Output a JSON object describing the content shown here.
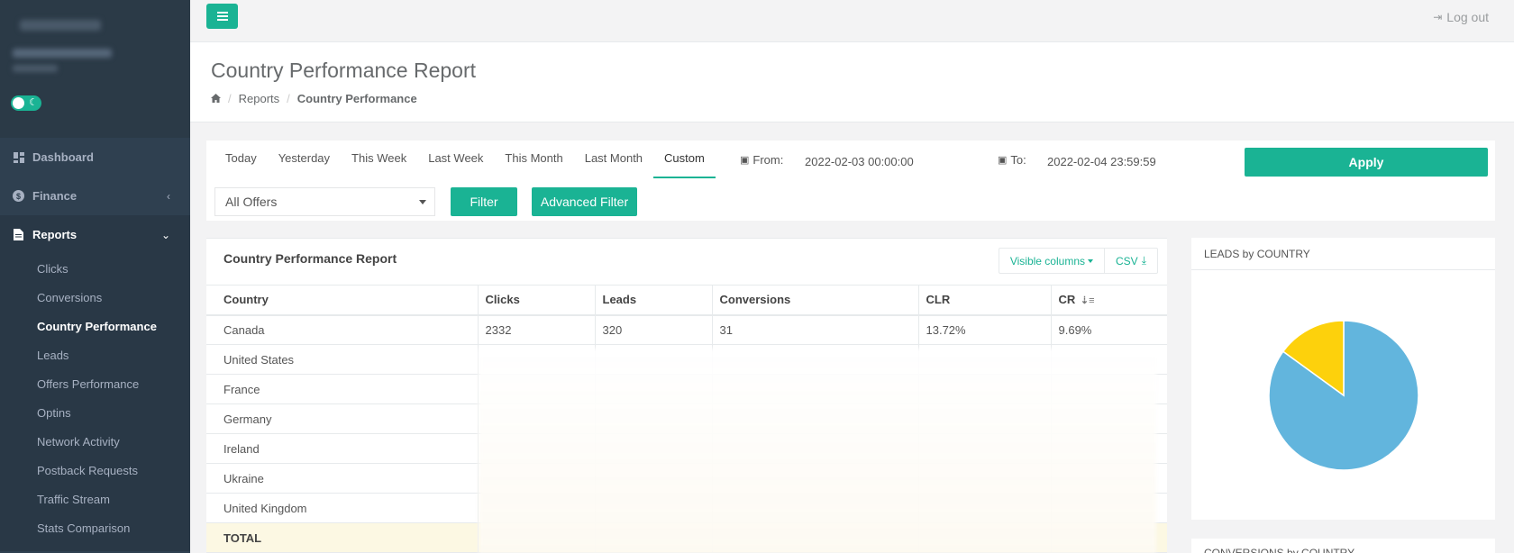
{
  "sidebar": {
    "items": [
      {
        "label": "Dashboard",
        "icon": "dashboard-icon"
      },
      {
        "label": "Finance",
        "icon": "dollar-icon"
      },
      {
        "label": "Reports",
        "icon": "file-icon"
      }
    ],
    "reports_sub": [
      "Clicks",
      "Conversions",
      "Country Performance",
      "Leads",
      "Offers Performance",
      "Optins",
      "Network Activity",
      "Postback Requests",
      "Traffic Stream",
      "Stats Comparison"
    ],
    "current": "Country Performance"
  },
  "topbar": {
    "logout_label": "Log out"
  },
  "heading": {
    "title": "Country Performance Report",
    "breadcrumb": [
      "Reports",
      "Country Performance"
    ]
  },
  "filters": {
    "tabs": [
      "Today",
      "Yesterday",
      "This Week",
      "Last Week",
      "This Month",
      "Last Month",
      "Custom"
    ],
    "active_tab": "Custom",
    "from_label": "From:",
    "from_value": "2022-02-03 00:00:00",
    "to_label": "To:",
    "to_value": "2022-02-04 23:59:59",
    "apply_label": "Apply",
    "offer_select": "All Offers",
    "filter_label": "Filter",
    "advanced_filter_label": "Advanced Filter"
  },
  "report": {
    "title": "Country Performance Report",
    "visible_columns_label": "Visible columns",
    "csv_label": "CSV",
    "columns": [
      "Country",
      "Clicks",
      "Leads",
      "Conversions",
      "CLR",
      "CR"
    ],
    "rows": [
      [
        "Canada",
        "2332",
        "320",
        "31",
        "13.72%",
        "9.69%"
      ],
      [
        "United States",
        "",
        "",
        "",
        "",
        ""
      ],
      [
        "France",
        "",
        "",
        "",
        "",
        ""
      ],
      [
        "Germany",
        "",
        "",
        "",
        "",
        ""
      ],
      [
        "Ireland",
        "",
        "",
        "",
        "",
        ""
      ],
      [
        "Ukraine",
        "",
        "",
        "",
        "",
        ""
      ],
      [
        "United Kingdom",
        "",
        "",
        "",
        "",
        ""
      ]
    ],
    "total_label": "TOTAL"
  },
  "leads_chart": {
    "title": "LEADS by COUNTRY",
    "chart_data": {
      "type": "pie",
      "values": [
        85,
        15
      ],
      "colors": [
        "#62b5dd",
        "#fdd10c"
      ]
    }
  },
  "conversions_chart": {
    "title": "CONVERSIONS by COUNTRY"
  },
  "colors": {
    "accent": "#1ab394",
    "sidebar": "#2f4050"
  }
}
